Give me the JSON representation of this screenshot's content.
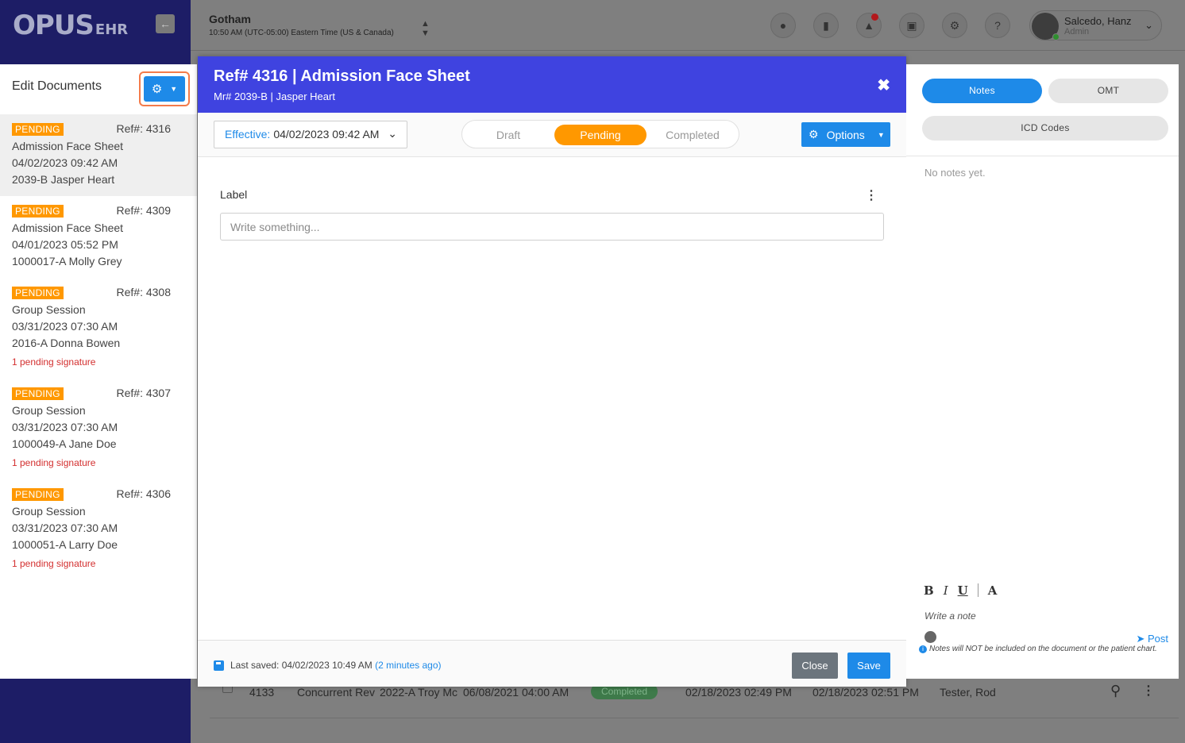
{
  "brand": {
    "logo": "OPUS",
    "logo_suffix": "EHR"
  },
  "topbar": {
    "facility": "Gotham",
    "time": "10:50 AM (UTC-05:00) Eastern Time (US & Canada)",
    "user_name": "Salcedo, Hanz",
    "user_role": "Admin"
  },
  "docs_panel": {
    "title": "Edit Documents",
    "items": [
      {
        "status": "PENDING",
        "ref": "Ref#: 4316",
        "type": "Admission Face Sheet",
        "date": "04/02/2023 09:42 AM",
        "patient": "2039-B Jasper Heart",
        "signature": ""
      },
      {
        "status": "PENDING",
        "ref": "Ref#: 4309",
        "type": "Admission Face Sheet",
        "date": "04/01/2023 05:52 PM",
        "patient": "1000017-A Molly Grey",
        "signature": ""
      },
      {
        "status": "PENDING",
        "ref": "Ref#: 4308",
        "type": "Group Session",
        "date": "03/31/2023 07:30 AM",
        "patient": "2016-A Donna Bowen",
        "signature": "1 pending signature"
      },
      {
        "status": "PENDING",
        "ref": "Ref#: 4307",
        "type": "Group Session",
        "date": "03/31/2023 07:30 AM",
        "patient": "1000049-A Jane Doe",
        "signature": "1 pending signature"
      },
      {
        "status": "PENDING",
        "ref": "Ref#: 4306",
        "type": "Group Session",
        "date": "03/31/2023 07:30 AM",
        "patient": "1000051-A Larry Doe",
        "signature": "1 pending signature"
      }
    ]
  },
  "modal": {
    "title": "Ref# 4316 | Admission Face Sheet",
    "subtitle": "Mr# 2039-B | Jasper Heart",
    "effective_label": "Effective:",
    "effective_value": "04/02/2023 09:42 AM",
    "status_options": [
      "Draft",
      "Pending",
      "Completed"
    ],
    "active_status": "Pending",
    "options_label": "Options",
    "field_label": "Label",
    "field_placeholder": "Write something...",
    "last_saved": "Last saved: 04/02/2023 10:49 AM",
    "saved_ago": "(2 minutes ago)",
    "close_label": "Close",
    "save_label": "Save"
  },
  "notes_panel": {
    "tab_notes": "Notes",
    "tab_omt": "OMT",
    "tab_icd": "ICD Codes",
    "empty_text": "No notes yet.",
    "format_bold": "B",
    "format_italic": "I",
    "format_underline": "U",
    "format_font": "A",
    "note_placeholder": "Write a note",
    "post_label": "Post",
    "warning": "Notes will NOT be included on the document or the patient chart."
  },
  "background_row": {
    "ref": "4133",
    "type": "Concurrent Rev",
    "patient": "2022-A Troy Mc",
    "date": "06/08/2021 04:00 AM",
    "status": "Completed",
    "created": "02/18/2023 02:49 PM",
    "updated": "02/18/2023 02:51 PM",
    "author": "Tester, Rod"
  }
}
